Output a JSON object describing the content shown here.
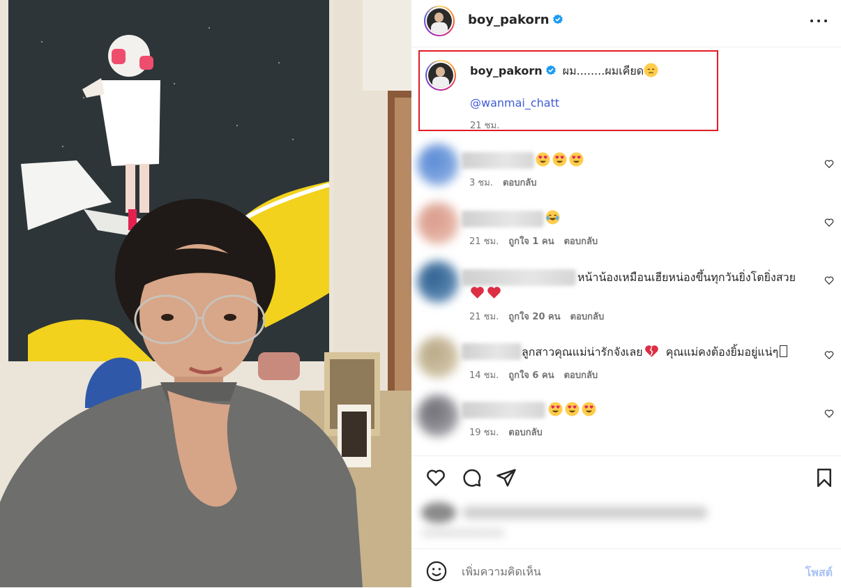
{
  "post": {
    "author": "boy_pakorn",
    "verified": true,
    "more_icon": "more-horizontal-icon"
  },
  "caption": {
    "author": "boy_pakorn",
    "text": "ผม........ผมเคียด",
    "emoji": "pensive-face",
    "mention": "@wanmai_chatt",
    "time": "21 ชม."
  },
  "comments": [
    {
      "text": "",
      "emojis": [
        "heart-eyes",
        "heart-eyes",
        "heart-eyes"
      ],
      "time": "3 ชม.",
      "likes": "",
      "reply": "ตอบกลับ"
    },
    {
      "text": "",
      "emojis": [
        "tears-of-joy"
      ],
      "time": "21 ชม.",
      "likes": "ถูกใจ 1 คน",
      "reply": "ตอบกลับ"
    },
    {
      "text": "หน้าน้องเหมือนเฮียหน่องขึ้นทุกวันยิ่งโตยิ่งสวย",
      "emojis": [
        "red-heart",
        "red-heart"
      ],
      "time": "21 ชม.",
      "likes": "ถูกใจ 20 คน",
      "reply": "ตอบกลับ"
    },
    {
      "text": "ลูกสาวคุณแม่น่ารักจังเลย",
      "text2": "คุณแม่คงต้องยิ้มอยู่แน่ๆ",
      "emojis": [
        "broken-heart"
      ],
      "time": "14 ชม.",
      "likes": "ถูกใจ 6 คน",
      "reply": "ตอบกลับ"
    },
    {
      "text": "",
      "emojis": [
        "heart-eyes",
        "heart-eyes",
        "heart-eyes"
      ],
      "time": "19 ชม.",
      "likes": "",
      "reply": "ตอบกลับ"
    }
  ],
  "actions": {
    "like_icon": "heart-icon",
    "comment_icon": "comment-icon",
    "share_icon": "send-icon",
    "save_icon": "bookmark-icon"
  },
  "composer": {
    "placeholder": "เพิ่มความคิดเห็น",
    "post_label": "โพสต์",
    "emoji_icon": "smiley-icon"
  },
  "colors": {
    "highlight_box": "#e21b23",
    "mention": "#3f5bd6",
    "verified": "#1d9bf0",
    "post_button_disabled": "#a9c3f3"
  }
}
